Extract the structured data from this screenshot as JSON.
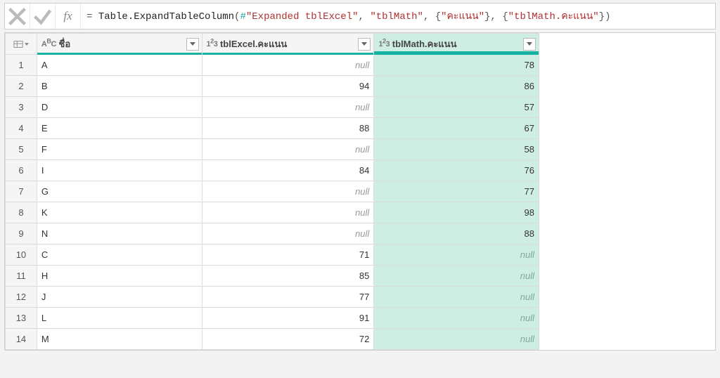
{
  "formula": {
    "prefix": "= ",
    "fn": "Table.ExpandTableColumn",
    "open": "(",
    "hash": "#",
    "q1": "\"Expanded tblExcel\"",
    "c1": ", ",
    "q2": "\"tblMath\"",
    "c2": ", ",
    "ob1": "{",
    "q3": "\"คะแนน\"",
    "cb1": "}",
    "c3": ", ",
    "ob2": "{",
    "q4": "\"tblMath.คะแนน\"",
    "cb2": "}",
    "close": ")"
  },
  "null_label": "null",
  "columns": [
    {
      "label": "ชื่อ",
      "type": "text"
    },
    {
      "label": "tblExcel.คะแนน",
      "type": "number"
    },
    {
      "label": "tblMath.คะแนน",
      "type": "number",
      "selected": true
    }
  ],
  "rows": [
    {
      "n": "1",
      "name": "A",
      "excel": null,
      "math": "78"
    },
    {
      "n": "2",
      "name": "B",
      "excel": "94",
      "math": "86"
    },
    {
      "n": "3",
      "name": "D",
      "excel": null,
      "math": "57"
    },
    {
      "n": "4",
      "name": "E",
      "excel": "88",
      "math": "67"
    },
    {
      "n": "5",
      "name": "F",
      "excel": null,
      "math": "58"
    },
    {
      "n": "6",
      "name": "I",
      "excel": "84",
      "math": "76"
    },
    {
      "n": "7",
      "name": "G",
      "excel": null,
      "math": "77"
    },
    {
      "n": "8",
      "name": "K",
      "excel": null,
      "math": "98"
    },
    {
      "n": "9",
      "name": "N",
      "excel": null,
      "math": "88"
    },
    {
      "n": "10",
      "name": "C",
      "excel": "71",
      "math": null
    },
    {
      "n": "11",
      "name": "H",
      "excel": "85",
      "math": null
    },
    {
      "n": "12",
      "name": "J",
      "excel": "77",
      "math": null
    },
    {
      "n": "13",
      "name": "L",
      "excel": "91",
      "math": null
    },
    {
      "n": "14",
      "name": "M",
      "excel": "72",
      "math": null
    }
  ]
}
